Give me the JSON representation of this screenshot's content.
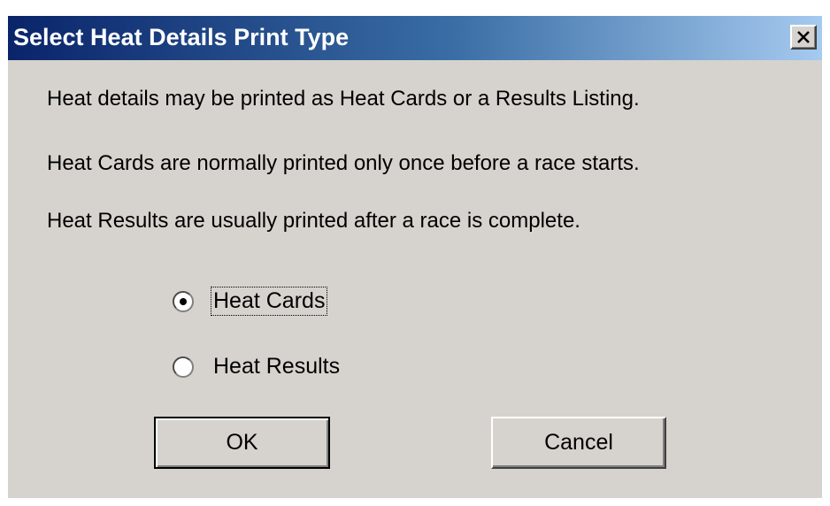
{
  "dialog": {
    "title": "Select Heat Details Print Type",
    "messages": [
      "Heat details may be printed as Heat Cards or a Results Listing.",
      "Heat Cards are normally printed only once before a race starts.",
      "Heat Results are usually printed after a race is complete."
    ],
    "options": [
      {
        "label": "Heat Cards",
        "selected": true
      },
      {
        "label": "Heat Results",
        "selected": false
      }
    ],
    "ok_label": "OK",
    "cancel_label": "Cancel"
  },
  "colors": {
    "title_bar_start": "#0a246a",
    "title_bar_end": "#a6caf0",
    "dialog_background": "#d6d3ce"
  },
  "icons": {
    "close": "close-icon",
    "radio_selected": "radio-selected-icon",
    "radio_unselected": "radio-unselected-icon"
  }
}
